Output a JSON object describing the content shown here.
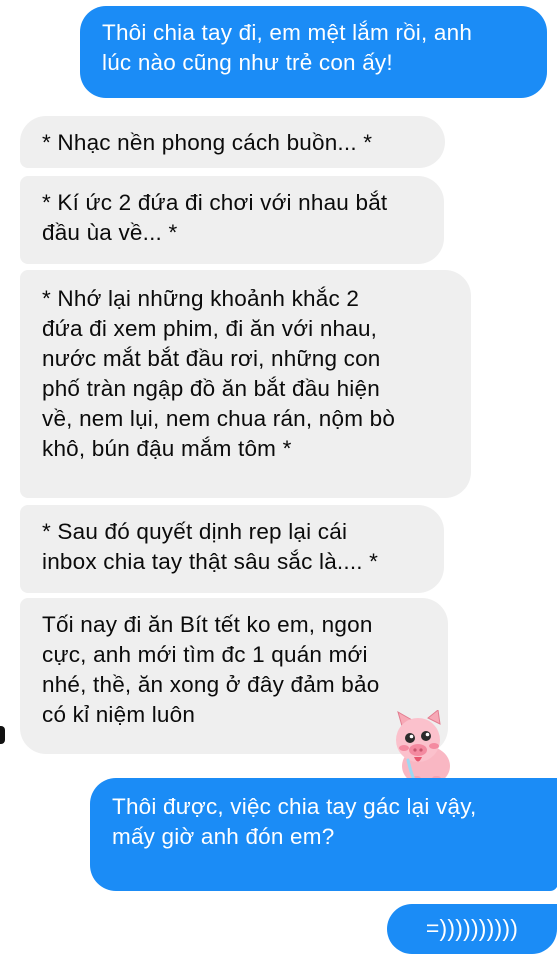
{
  "messages": [
    {
      "id": "b1",
      "direction": "out",
      "lines": [
        "Thôi chia tay đi, em mệt lắm rồi, anh",
        "lúc nào cũng như trẻ con ấy!"
      ]
    },
    {
      "id": "b2",
      "direction": "in",
      "lines": [
        "* Nhạc nền phong cách buồn... *"
      ]
    },
    {
      "id": "b3",
      "direction": "in",
      "lines": [
        "* Kí ức 2 đứa đi chơi với nhau bắt",
        "đầu ùa về... *"
      ]
    },
    {
      "id": "b4",
      "direction": "in",
      "lines": [
        "* Nhớ lại những khoảnh khắc 2",
        "đứa đi xem phim, đi ăn với nhau,",
        "nước mắt bắt đầu rơi, những con",
        "phố tràn ngập đồ ăn bắt đầu hiện",
        "về, nem lụi, nem chua rán, nộm bò",
        "khô, bún đậu mắm tôm *"
      ]
    },
    {
      "id": "b5",
      "direction": "in",
      "lines": [
        "* Sau đó quyết dịnh rep lại cái",
        "inbox chia tay thật sâu sắc là.... *"
      ]
    },
    {
      "id": "b6",
      "direction": "in",
      "lines": [
        "Tối nay đi ăn Bít tết ko em, ngon",
        "cực, anh mới tìm đc 1 quán mới",
        "nhé, thề, ăn xong ở đây đảm bảo",
        "có kỉ niệm luôn"
      ]
    },
    {
      "id": "b7",
      "direction": "out",
      "lines": [
        "Thôi được, việc chia tay gác lại vậy,",
        "mấy giờ anh đón em?"
      ]
    },
    {
      "id": "b8",
      "direction": "out",
      "lines": [
        "=))))))))))"
      ]
    }
  ],
  "reaction": {
    "icon": "pig-sticker-icon"
  },
  "colors": {
    "outgoing": "#1b8cf6",
    "incoming": "#efefef",
    "incoming_text": "#0b0b0b",
    "outgoing_text": "#ffffff"
  }
}
